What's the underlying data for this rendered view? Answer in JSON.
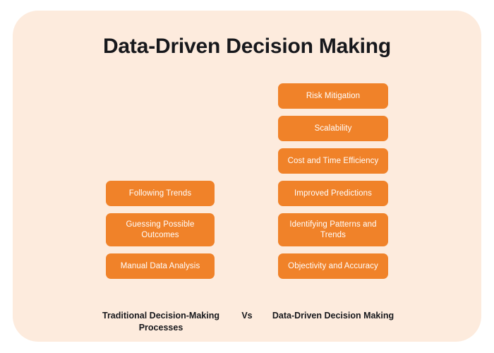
{
  "card": {
    "background_color": "#FDEBDD",
    "title": "Data-Driven Decision Making"
  },
  "colors": {
    "pill": "#F08229",
    "pill_text": "#FFFFFF",
    "card_background": "#FDEBDD",
    "page_background": "#FFFFFF",
    "heading_text": "#17181C"
  },
  "columns": {
    "traditional": {
      "footer_label": "Traditional Decision-Making Processes",
      "items": [
        {
          "label": "Following Trends",
          "lines": 1
        },
        {
          "label": "Guessing Possible Outcomes",
          "lines": 2
        },
        {
          "label": "Manual Data Analysis",
          "lines": 1
        }
      ]
    },
    "datadriven": {
      "footer_label": "Data-Driven Decision Making",
      "items": [
        {
          "label": "Risk Mitigation",
          "lines": 1
        },
        {
          "label": "Scalability",
          "lines": 1
        },
        {
          "label": "Cost and Time Efficiency",
          "lines": 1
        },
        {
          "label": "Improved Predictions",
          "lines": 1
        },
        {
          "label": "Identifying Patterns and Trends",
          "lines": 2
        },
        {
          "label": "Objectivity and Accuracy",
          "lines": 1
        }
      ]
    }
  },
  "separator": {
    "label": "Vs"
  }
}
